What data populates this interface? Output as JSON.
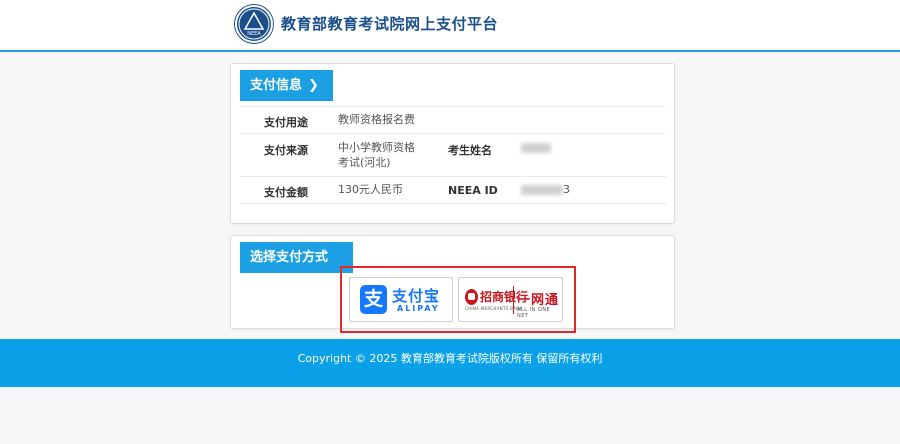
{
  "header": {
    "site_title": "教育部教育考试院网上支付平台",
    "logo_text": "NEEA"
  },
  "payment_info": {
    "section_title": "支付信息",
    "purpose_label": "支付用途",
    "purpose_value": "教师资格报名费",
    "source_label": "支付来源",
    "source_value_line1": "中小学教师资格",
    "source_value_line2": "考试(河北)",
    "name_label": "考生姓名",
    "amount_label": "支付金额",
    "amount_value": "130元人民币",
    "neea_label": "NEEA ID",
    "neea_suffix": "3"
  },
  "payment_method": {
    "section_title": "选择支付方式",
    "alipay": {
      "cn": "支付宝",
      "en": "ALIPAY",
      "icon_char": "支"
    },
    "cmb": {
      "cn": "招商银行",
      "sub": "CHINA MERCHANTS BANK",
      "net_cn": "一网通",
      "net_en": "ALL IN ONE NET"
    }
  },
  "footer": {
    "copyright": "Copyright © 2025 教育部教育考试院版权所有 保留所有权利"
  },
  "colors": {
    "accent": "#1ca0e3",
    "footer_bg": "#0aa1e8",
    "highlight": "#e02a2a",
    "alipay_blue": "#1677ff",
    "cmb_red": "#c8161e"
  }
}
